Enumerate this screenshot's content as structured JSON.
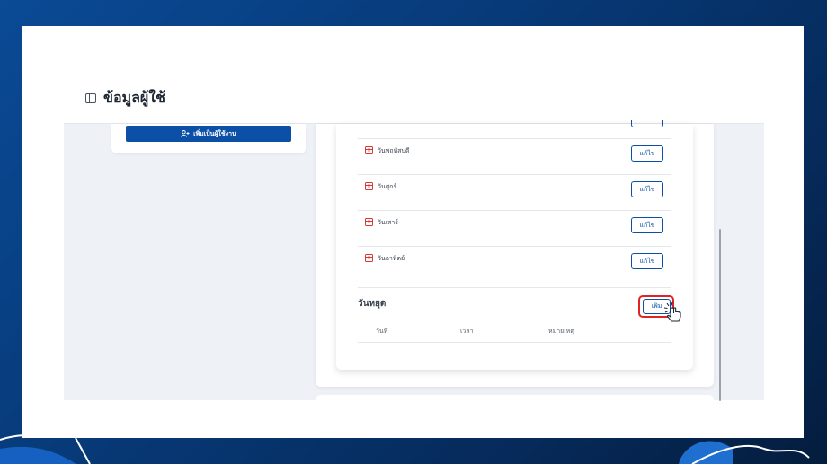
{
  "header": {
    "title": "ข้อมูลผู้ใช้",
    "icon": "sidebar-panel-icon"
  },
  "sidebar": {
    "add_user_label": "เพิ่มเป็นผู้ใช้งาน",
    "add_user_icon": "user-plus-icon"
  },
  "schedule": {
    "days": [
      {
        "label": "วันพฤหัสบดี",
        "edit_label": "แก้ไข"
      },
      {
        "label": "วันศุกร์",
        "edit_label": "แก้ไข"
      },
      {
        "label": "วันเสาร์",
        "edit_label": "แก้ไข"
      },
      {
        "label": "วันอาทิตย์",
        "edit_label": "แก้ไข"
      }
    ]
  },
  "holidays": {
    "title": "วันหยุด",
    "add_label": "เพิ่ม",
    "columns": [
      "วันที่",
      "เวลา",
      "หมายเหตุ"
    ]
  },
  "colors": {
    "primary": "#0b4fa6",
    "danger": "#d93838",
    "highlight": "#e02424"
  }
}
